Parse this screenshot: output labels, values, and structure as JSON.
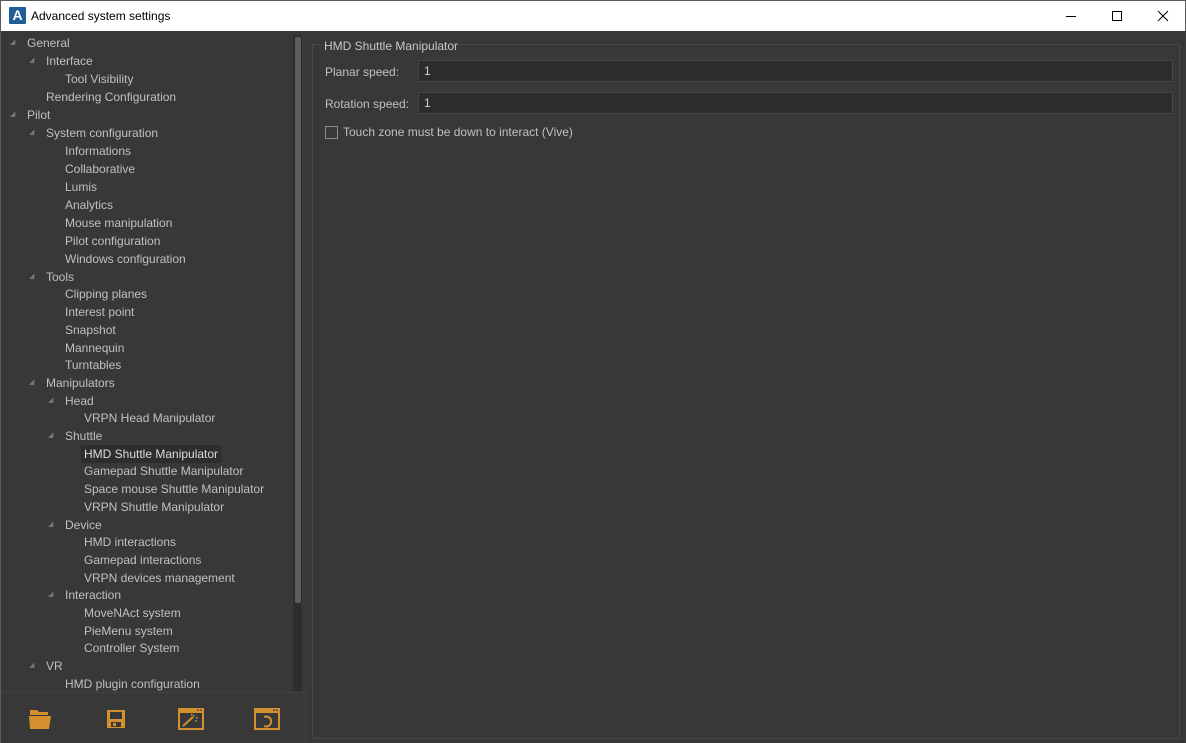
{
  "window": {
    "title": "Advanced system settings",
    "app_icon_letter": "A",
    "controls": [
      "minimize",
      "maximize",
      "close"
    ]
  },
  "tree": {
    "items": [
      {
        "label": "General",
        "level": 0,
        "expanded": true,
        "has_children": true
      },
      {
        "label": "Interface",
        "level": 1,
        "expanded": true,
        "has_children": true
      },
      {
        "label": "Tool Visibility",
        "level": 2,
        "has_children": false
      },
      {
        "label": "Rendering Configuration",
        "level": 1,
        "has_children": false
      },
      {
        "label": "Pilot",
        "level": 0,
        "expanded": true,
        "has_children": true
      },
      {
        "label": "System configuration",
        "level": 1,
        "expanded": true,
        "has_children": true
      },
      {
        "label": "Informations",
        "level": 2,
        "has_children": false
      },
      {
        "label": "Collaborative",
        "level": 2,
        "has_children": false
      },
      {
        "label": "Lumis",
        "level": 2,
        "has_children": false
      },
      {
        "label": "Analytics",
        "level": 2,
        "has_children": false
      },
      {
        "label": "Mouse manipulation",
        "level": 2,
        "has_children": false
      },
      {
        "label": "Pilot configuration",
        "level": 2,
        "has_children": false
      },
      {
        "label": "Windows configuration",
        "level": 2,
        "has_children": false
      },
      {
        "label": "Tools",
        "level": 1,
        "expanded": true,
        "has_children": true
      },
      {
        "label": "Clipping planes",
        "level": 2,
        "has_children": false
      },
      {
        "label": "Interest point",
        "level": 2,
        "has_children": false
      },
      {
        "label": "Snapshot",
        "level": 2,
        "has_children": false
      },
      {
        "label": "Mannequin",
        "level": 2,
        "has_children": false
      },
      {
        "label": "Turntables",
        "level": 2,
        "has_children": false
      },
      {
        "label": "Manipulators",
        "level": 1,
        "expanded": true,
        "has_children": true
      },
      {
        "label": "Head",
        "level": 2,
        "expanded": true,
        "has_children": true
      },
      {
        "label": "VRPN Head Manipulator",
        "level": 3,
        "has_children": false
      },
      {
        "label": "Shuttle",
        "level": 2,
        "expanded": true,
        "has_children": true
      },
      {
        "label": "HMD Shuttle Manipulator",
        "level": 3,
        "has_children": false,
        "selected": true
      },
      {
        "label": "Gamepad Shuttle Manipulator",
        "level": 3,
        "has_children": false
      },
      {
        "label": "Space mouse Shuttle Manipulator",
        "level": 3,
        "has_children": false
      },
      {
        "label": "VRPN Shuttle Manipulator",
        "level": 3,
        "has_children": false
      },
      {
        "label": "Device",
        "level": 2,
        "expanded": true,
        "has_children": true
      },
      {
        "label": "HMD interactions",
        "level": 3,
        "has_children": false
      },
      {
        "label": "Gamepad interactions",
        "level": 3,
        "has_children": false
      },
      {
        "label": "VRPN devices management",
        "level": 3,
        "has_children": false
      },
      {
        "label": "Interaction",
        "level": 2,
        "expanded": true,
        "has_children": true
      },
      {
        "label": "MoveNAct system",
        "level": 3,
        "has_children": false
      },
      {
        "label": "PieMenu system",
        "level": 3,
        "has_children": false
      },
      {
        "label": "Controller System",
        "level": 3,
        "has_children": false
      },
      {
        "label": "VR",
        "level": 1,
        "expanded": true,
        "has_children": true
      },
      {
        "label": "HMD plugin configuration",
        "level": 2,
        "has_children": false
      }
    ]
  },
  "toolbar": {
    "buttons": [
      {
        "name": "open-folder",
        "icon": "folder-open-icon"
      },
      {
        "name": "save",
        "icon": "floppy-disk-icon"
      },
      {
        "name": "apply-defaults",
        "icon": "magic-wand-window-icon"
      },
      {
        "name": "reset",
        "icon": "undo-window-icon"
      }
    ],
    "accent_color": "#d4902e"
  },
  "panel": {
    "title": "HMD Shuttle Manipulator",
    "fields": [
      {
        "label": "Planar speed:",
        "value": "1"
      },
      {
        "label": "Rotation speed:",
        "value": "1"
      }
    ],
    "checkbox": {
      "label": "Touch zone must be down to interact (Vive)",
      "checked": false
    }
  }
}
